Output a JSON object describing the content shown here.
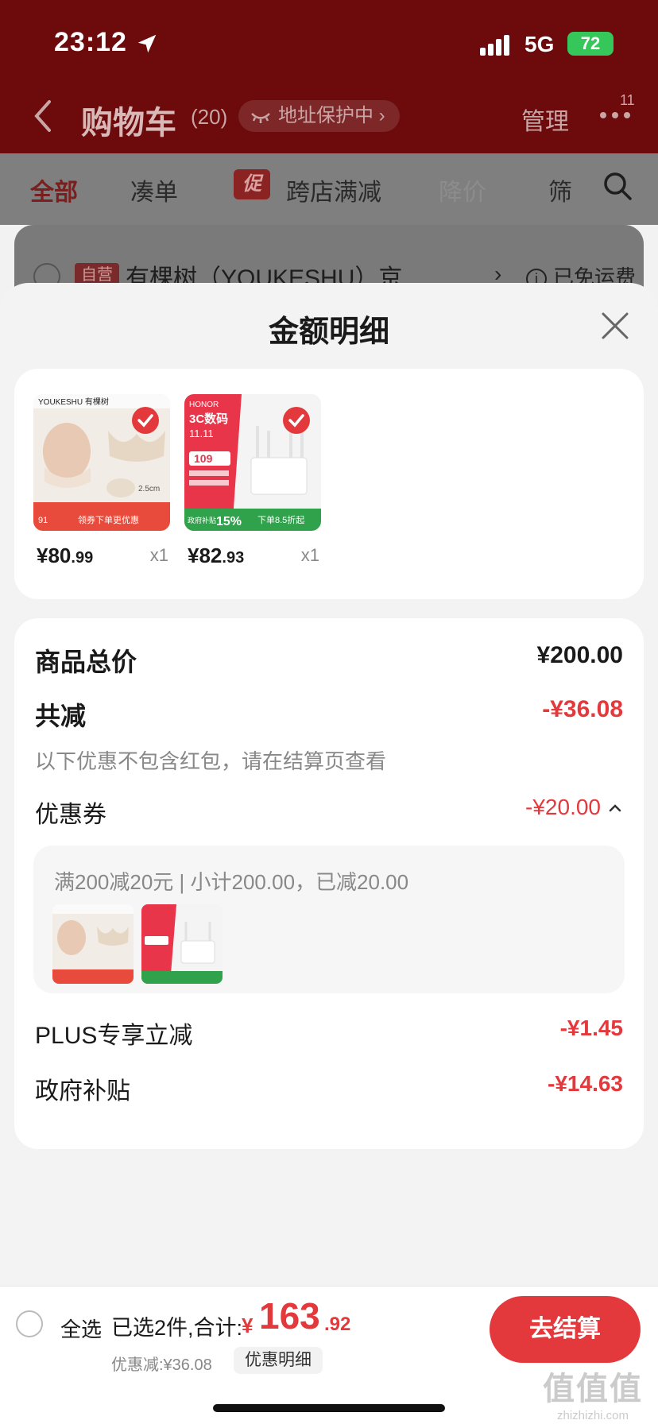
{
  "status_bar": {
    "time": "23:12",
    "network": "5G",
    "battery": "72"
  },
  "header": {
    "title": "购物车",
    "count": "(20)",
    "address_protection": "地址保护中",
    "address_chevron": "›",
    "manage": "管理",
    "more_badge": "11"
  },
  "filter_tabs": {
    "all": "全部",
    "bundle": "凑单",
    "promo_tag": "促",
    "cross_store": "跨店满减",
    "price_drop": "降价",
    "filter": "筛"
  },
  "store": {
    "tag": "自营",
    "name": "有棵树（YOUKESHU）京…",
    "chevron": "›",
    "shipping_icon_text": "i",
    "shipping": "已免运费"
  },
  "sheet": {
    "title": "金额明细",
    "products": [
      {
        "brand": "YOUKESHU 有棵树",
        "price_int": "¥80",
        "price_dec": ".99",
        "qty": "x1"
      },
      {
        "brand": "HONOR",
        "price_int": "¥82",
        "price_dec": ".93",
        "qty": "x1"
      }
    ],
    "product_thumb_text": {
      "bra_size": "2.5cm",
      "bra_banner": "领券下单更优惠",
      "bra_badge": "91",
      "router_title": "3C数码",
      "router_date": "11.11",
      "router_price": "109",
      "router_subsidy": "政府补贴",
      "router_pct": "15%",
      "router_promo": "下单8.5折起"
    },
    "total": {
      "label": "商品总价",
      "value": "¥200.00"
    },
    "reduction": {
      "label": "共减",
      "value": "-¥36.08",
      "note": "以下优惠不包含红包，请在结算页查看"
    },
    "coupon": {
      "label": "优惠券",
      "value": "-¥20.00",
      "detail": "满200减20元 | 小计200.00，已减20.00"
    },
    "plus": {
      "label": "PLUS专享立减",
      "value": "-¥1.45"
    },
    "gov_subsidy": {
      "label": "政府补贴",
      "value": "-¥14.63"
    }
  },
  "bottom_bar": {
    "select_all": "全选",
    "summary": "已选2件,合计:",
    "total_yen": "¥",
    "total_int": "163",
    "total_dec": ".92",
    "discount": "优惠减:¥36.08",
    "detail_button": "优惠明细",
    "checkout": "去结算",
    "watermark_big": "值值值",
    "watermark_small": "zhizhizhi.com"
  },
  "colors": {
    "accent": "#e4393c",
    "header_bg": "#6c0a0c"
  },
  "icons": [
    "location-arrow-icon",
    "signal-icon",
    "back-icon",
    "eye-closed-icon",
    "more-icon",
    "search-icon",
    "close-icon",
    "check-icon",
    "chevron-up-icon"
  ]
}
